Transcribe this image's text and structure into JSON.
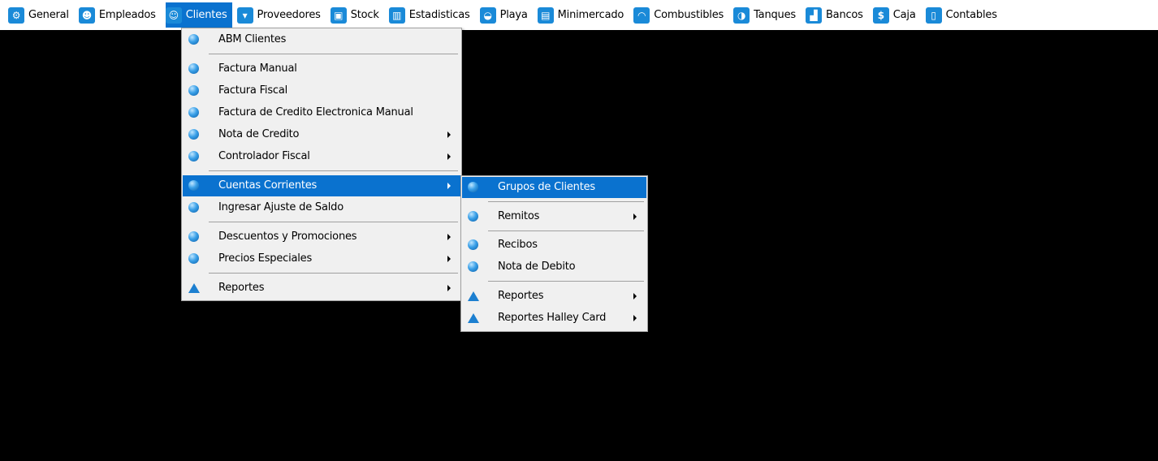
{
  "menubar": {
    "items": [
      {
        "label": "General",
        "icon": "gear-icon",
        "glyph": "⚙"
      },
      {
        "label": "Empleados",
        "icon": "person-icon",
        "glyph": "☻"
      },
      {
        "label": "Clientes",
        "icon": "user-icon",
        "glyph": "☺"
      },
      {
        "label": "Proveedores",
        "icon": "truck-icon",
        "glyph": "▾"
      },
      {
        "label": "Stock",
        "icon": "box-icon",
        "glyph": "▣"
      },
      {
        "label": "Estadisticas",
        "icon": "chart-icon",
        "glyph": "▥"
      },
      {
        "label": "Playa",
        "icon": "car-icon",
        "glyph": "◒"
      },
      {
        "label": "Minimercado",
        "icon": "cash-register-icon",
        "glyph": "▤"
      },
      {
        "label": "Combustibles",
        "icon": "fuel-icon",
        "glyph": "◠"
      },
      {
        "label": "Tanques",
        "icon": "tank-icon",
        "glyph": "◑"
      },
      {
        "label": "Bancos",
        "icon": "bank-icon",
        "glyph": "▟"
      },
      {
        "label": "Caja",
        "icon": "dollar-icon",
        "glyph": "$"
      },
      {
        "label": "Contables",
        "icon": "document-icon",
        "glyph": "▯"
      }
    ]
  },
  "clientes_menu": {
    "items": [
      {
        "label": "ABM Clientes"
      },
      {
        "label": "Factura Manual"
      },
      {
        "label": "Factura Fiscal"
      },
      {
        "label": "Factura de Credito Electronica Manual"
      },
      {
        "label": "Nota de Credito"
      },
      {
        "label": "Controlador Fiscal"
      },
      {
        "label": "Cuentas Corrientes"
      },
      {
        "label": "Ingresar Ajuste de Saldo"
      },
      {
        "label": "Descuentos y Promociones"
      },
      {
        "label": "Precios Especiales"
      },
      {
        "label": "Reportes"
      }
    ]
  },
  "ctacte_menu": {
    "items": [
      {
        "label": "Grupos de Clientes"
      },
      {
        "label": "Remitos"
      },
      {
        "label": "Recibos"
      },
      {
        "label": "Nota de Debito"
      },
      {
        "label": "Reportes"
      },
      {
        "label": "Reportes Halley Card"
      }
    ]
  },
  "colors": {
    "highlight": "#0a72cf",
    "menu_bg": "#f0f0f0",
    "desktop": "#000000"
  }
}
